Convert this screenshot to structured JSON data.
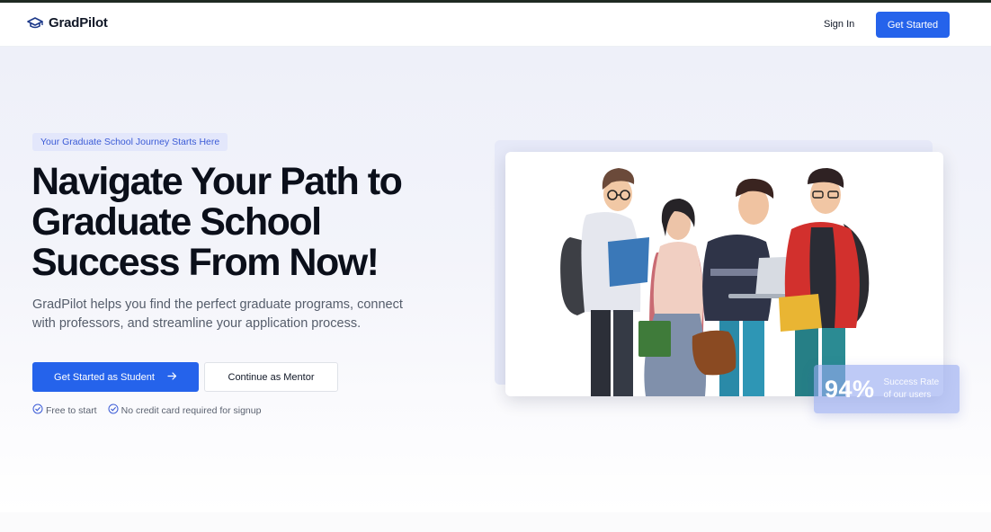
{
  "brand": {
    "name": "GradPilot",
    "icon": "graduation-cap-icon"
  },
  "nav": {
    "signin_label": "Sign In",
    "cta_label": "Get Started"
  },
  "hero": {
    "badge": "Your Graduate School Journey Starts Here",
    "headline_lines": [
      "Navigate Your Path to",
      "Graduate School",
      "Success From Now!"
    ],
    "description": "GradPilot helps you find the perfect graduate programs, connect with professors, and streamline your application process.",
    "primary_button": "Get Started as Student",
    "primary_button_icon": "arrow-right-icon",
    "secondary_button": "Continue as Mentor",
    "checks": [
      "Free to start",
      "No credit card required for signup"
    ]
  },
  "stat": {
    "value": "94%",
    "label_line1": "Success Rate",
    "label_line2": "of our users"
  },
  "colors": {
    "accent": "#2563eb",
    "heading": "#0b0f1a",
    "badge_bg": "#e3e7fb"
  }
}
